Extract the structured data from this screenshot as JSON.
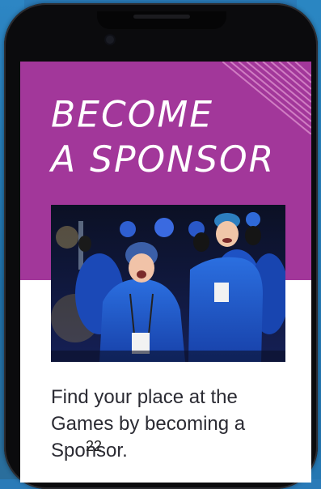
{
  "hero": {
    "title_line1": "BECOME",
    "title_line2": "A SPONSOR",
    "background_color": "#a2379a"
  },
  "photo": {
    "alt": "Crowd of people in blue jackets and hats cheering"
  },
  "body": {
    "text": "Find your place at the Games by becoming a Sponsor."
  },
  "page_number": "22"
}
